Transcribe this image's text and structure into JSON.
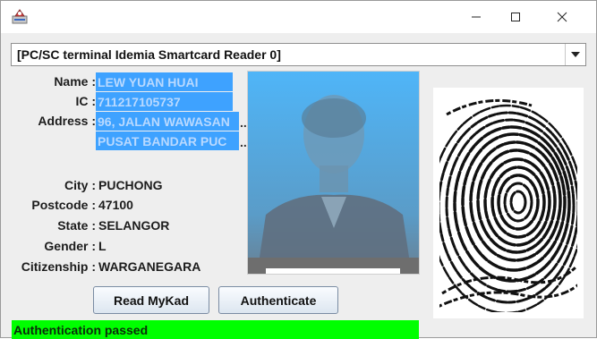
{
  "window": {
    "app_icon": "card-reader-app-icon",
    "minimize_icon": "minimize-icon",
    "maximize_icon": "maximize-icon",
    "close_icon": "close-icon"
  },
  "reader": {
    "selected": "[PC/SC terminal Idemia Smartcard Reader 0]",
    "dropdown_icon": "chevron-down-icon"
  },
  "labels": {
    "name": "Name :",
    "ic": "IC :",
    "address": "Address :",
    "city": "City :",
    "postcode": "Postcode :",
    "state": "State :",
    "gender": "Gender :",
    "citizenship": "Citizenship :"
  },
  "card": {
    "name": "LEW YUAN HUAI",
    "ic": "711217105737",
    "address_line1": "96, JALAN WAWASAN",
    "address_line2": "PUSAT BANDAR PUC",
    "ellipsis": "..",
    "city": "PUCHONG",
    "postcode": "47100",
    "state": "SELANGOR",
    "gender": "L",
    "citizenship": "WARGANEGARA"
  },
  "buttons": {
    "read": "Read MyKad",
    "authenticate": "Authenticate"
  },
  "status": {
    "text": "Authentication passed",
    "color": "#00ff00"
  },
  "colors": {
    "highlight": "#3ea2ff",
    "photo_background": "#43b0f6"
  }
}
